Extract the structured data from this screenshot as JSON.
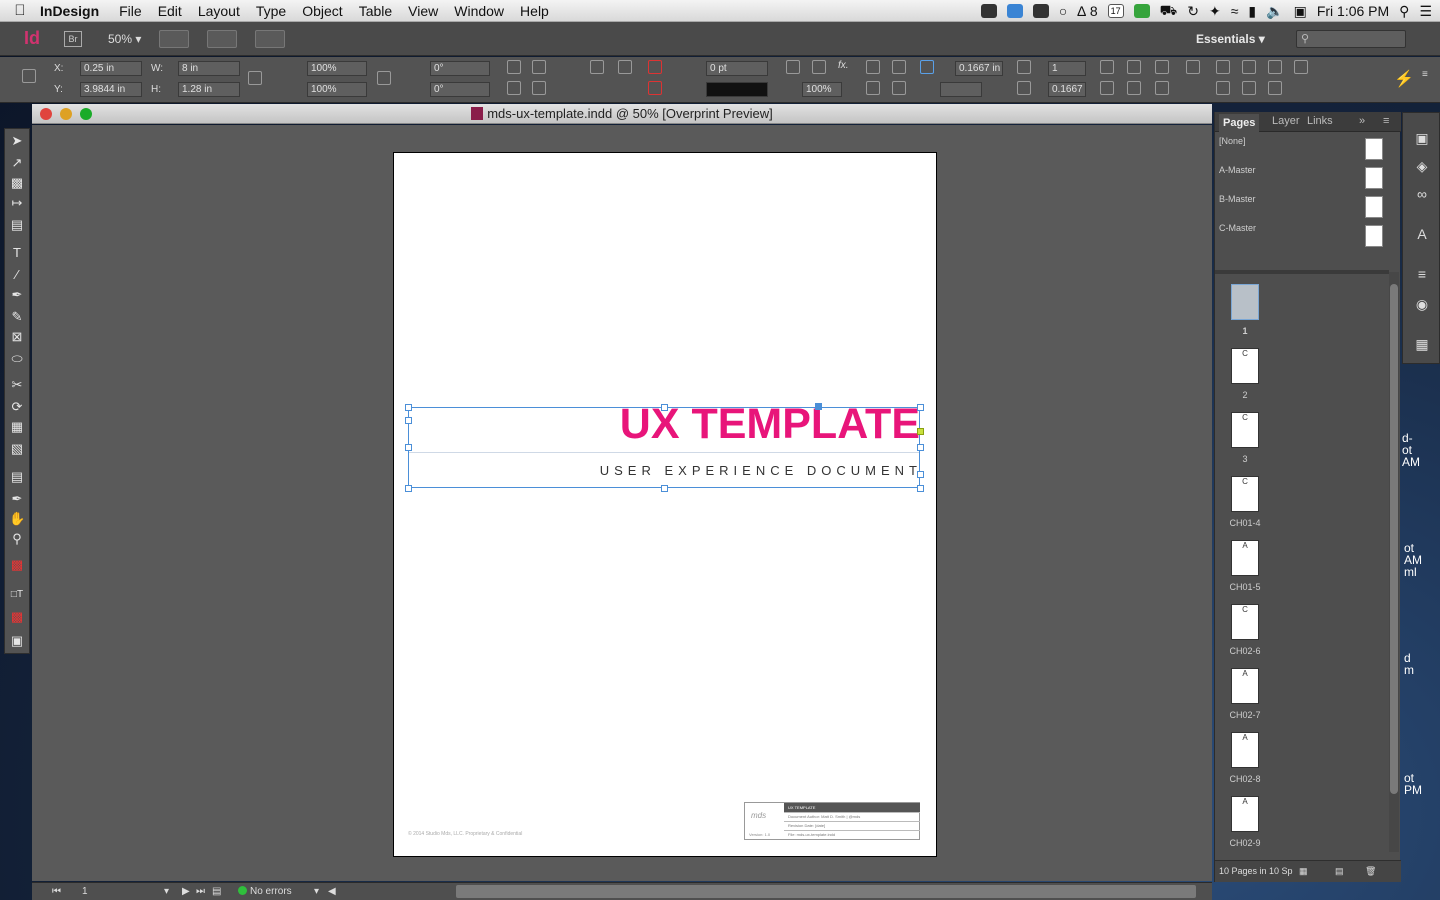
{
  "menubar": {
    "app": "InDesign",
    "items": [
      "File",
      "Edit",
      "Layout",
      "Type",
      "Object",
      "Table",
      "View",
      "Window",
      "Help"
    ],
    "adobe_count": "8",
    "calendar_day": "17",
    "clock": "Fri 1:06 PM"
  },
  "appbar": {
    "logo": "Id",
    "bridge": "Br",
    "zoom": "50%",
    "workspace": "Essentials"
  },
  "control": {
    "x_label": "X:",
    "x_value": "0.25 in",
    "y_label": "Y:",
    "y_value": "3.9844 in",
    "w_label": "W:",
    "w_value": "8 in",
    "h_label": "H:",
    "h_value": "1.28 in",
    "scale_x": "100%",
    "scale_y": "100%",
    "rotate": "0°",
    "shear": "0°",
    "stroke_weight": "0 pt",
    "opacity": "100%",
    "inset": "0.1667 in",
    "columns": "1",
    "gutter": "0.1667"
  },
  "document": {
    "title": "mds-ux-template.indd @ 50% [Overprint Preview]",
    "heading": "UX TEMPLATE",
    "subheading": "USER EXPERIENCE DOCUMENT",
    "footer_copy": "© 2014 Studio Mds, LLC. Proprietary & Confidential",
    "titleblock": {
      "header": "UX TEMPLATE",
      "rows": [
        "Document Author: Matt D. Smith | @mds",
        "Revision Date: [date]",
        "File: mds-ux-template.indd"
      ],
      "logo": "mds",
      "version": "Version: 1.0"
    }
  },
  "pages_panel": {
    "tabs": [
      "Pages",
      "Layer",
      "Links"
    ],
    "masters": [
      "[None]",
      "A-Master",
      "B-Master",
      "C-Master"
    ],
    "pages": [
      {
        "label": "1",
        "master": ""
      },
      {
        "label": "2",
        "master": "C"
      },
      {
        "label": "3",
        "master": "C"
      },
      {
        "label": "CH01-4",
        "master": "C"
      },
      {
        "label": "CH01-5",
        "master": "A"
      },
      {
        "label": "CH02-6",
        "master": "C"
      },
      {
        "label": "CH02-7",
        "master": "A"
      },
      {
        "label": "CH02-8",
        "master": "A"
      },
      {
        "label": "CH02-9",
        "master": "A"
      }
    ],
    "footer": "10 Pages in 10 Sp"
  },
  "status": {
    "page": "1",
    "preflight": "No errors"
  },
  "desktop_fragments": [
    "d-",
    "ot",
    "AM",
    "ot",
    "AM",
    "ml",
    "d",
    "m",
    "ot",
    "PM"
  ],
  "colors": {
    "accent": "#e8157a",
    "selection": "#4b8fd8"
  }
}
